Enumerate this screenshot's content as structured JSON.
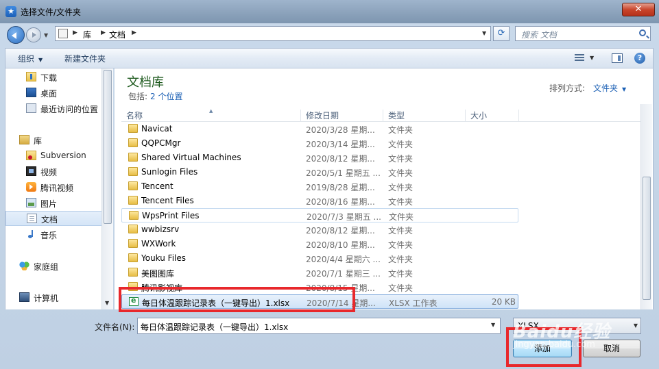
{
  "window": {
    "title": "选择文件/文件夹",
    "close_label": "✕"
  },
  "address_bar": {
    "crumbs": [
      "库",
      "文档"
    ],
    "search_placeholder": "搜索 文档"
  },
  "toolbar": {
    "organize_label": "组织",
    "new_folder_label": "新建文件夹"
  },
  "nav_pane": {
    "items": [
      {
        "label": "下载",
        "icon": "download-icon"
      },
      {
        "label": "桌面",
        "icon": "desktop-icon"
      },
      {
        "label": "最近访问的位置",
        "icon": "recent-places-icon"
      },
      {
        "label": "库",
        "icon": "library-icon"
      },
      {
        "label": "Subversion",
        "icon": "subversion-icon"
      },
      {
        "label": "视频",
        "icon": "video-icon"
      },
      {
        "label": "腾讯视频",
        "icon": "tencent-video-icon"
      },
      {
        "label": "图片",
        "icon": "picture-icon"
      },
      {
        "label": "文档",
        "icon": "document-icon",
        "selected": true
      },
      {
        "label": "音乐",
        "icon": "music-icon"
      },
      {
        "label": "家庭组",
        "icon": "homegroup-icon"
      },
      {
        "label": "计算机",
        "icon": "computer-icon"
      }
    ]
  },
  "library": {
    "title": "文档库",
    "includes_label": "包括:",
    "includes_link": "2 个位置",
    "sort_label": "排列方式:",
    "sort_value": "文件夹"
  },
  "columns": [
    "名称",
    "修改日期",
    "类型",
    "大小"
  ],
  "files": [
    {
      "name": "Navicat",
      "date": "2020/3/28 星期...",
      "type": "文件夹",
      "size": "",
      "icon": "folder-icon"
    },
    {
      "name": "QQPCMgr",
      "date": "2020/3/14 星期...",
      "type": "文件夹",
      "size": "",
      "icon": "folder-icon"
    },
    {
      "name": "Shared Virtual Machines",
      "date": "2020/8/12 星期...",
      "type": "文件夹",
      "size": "",
      "icon": "folder-icon"
    },
    {
      "name": "Sunlogin Files",
      "date": "2020/5/1 星期五 ...",
      "type": "文件夹",
      "size": "",
      "icon": "folder-icon"
    },
    {
      "name": "Tencent",
      "date": "2019/8/28 星期...",
      "type": "文件夹",
      "size": "",
      "icon": "folder-icon"
    },
    {
      "name": "Tencent Files",
      "date": "2020/8/16 星期...",
      "type": "文件夹",
      "size": "",
      "icon": "folder-icon"
    },
    {
      "name": "WpsPrint Files",
      "date": "2020/7/3 星期五 ...",
      "type": "文件夹",
      "size": "",
      "icon": "folder-icon",
      "hover": true
    },
    {
      "name": "wwbizsrv",
      "date": "2020/8/12 星期...",
      "type": "文件夹",
      "size": "",
      "icon": "folder-icon"
    },
    {
      "name": "WXWork",
      "date": "2020/8/10 星期...",
      "type": "文件夹",
      "size": "",
      "icon": "folder-icon"
    },
    {
      "name": "Youku Files",
      "date": "2020/4/4 星期六 ...",
      "type": "文件夹",
      "size": "",
      "icon": "folder-icon"
    },
    {
      "name": "美图图库",
      "date": "2020/7/1 星期三 ...",
      "type": "文件夹",
      "size": "",
      "icon": "folder-icon"
    },
    {
      "name": "腾讯影视库",
      "date": "2020/8/15 星期...",
      "type": "文件夹",
      "size": "",
      "icon": "folder-icon"
    },
    {
      "name": "每日体温跟踪记录表（一键导出）1.xlsx",
      "date": "2020/7/14 星期...",
      "type": "XLSX 工作表",
      "size": "20 KB",
      "icon": "xlsx-file-icon",
      "selected": true
    }
  ],
  "bottom": {
    "filename_label": "文件名(N):",
    "filename_value": "每日体温跟踪记录表（一键导出）1.xlsx",
    "filetype_value": "XLSX",
    "add_label": "添加",
    "cancel_label": "取消"
  },
  "watermark": {
    "text": "Baidu经验",
    "sub": "jingyan.baidu.com"
  },
  "colors": {
    "highlight": "#e8282c",
    "library_title": "#1e5a1e",
    "link": "#1a5fb4",
    "selection": "#cfe3f8"
  }
}
